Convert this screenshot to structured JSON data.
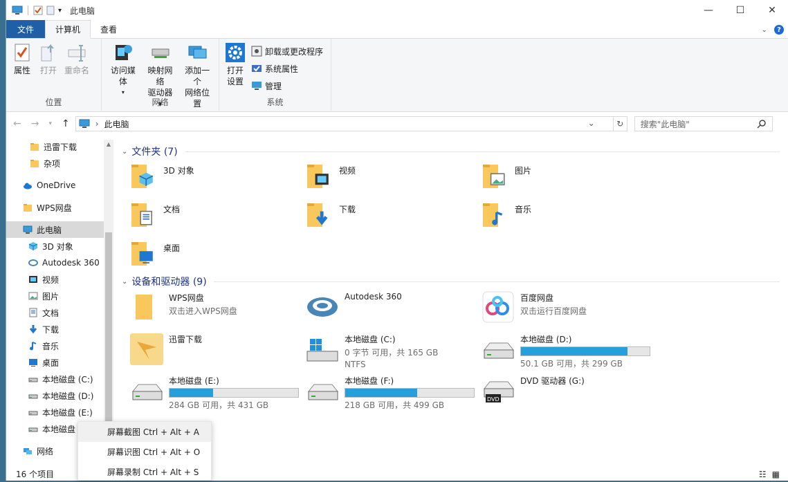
{
  "window": {
    "title": "此电脑",
    "controls": [
      "—",
      "☐",
      "✕"
    ]
  },
  "tabs": {
    "file": "文件",
    "computer": "计算机",
    "view": "查看"
  },
  "ribbon": {
    "location": {
      "label": "位置",
      "properties": "属性",
      "open": "打开",
      "rename": "重命名"
    },
    "network": {
      "label": "网络",
      "access_media": "访问媒体",
      "map_drive_1": "映射网络",
      "map_drive_2": "驱动器",
      "add_location_1": "添加一个",
      "add_location_2": "网络位置"
    },
    "system": {
      "label": "系统",
      "open_settings_1": "打开",
      "open_settings_2": "设置",
      "uninstall": "卸载或更改程序",
      "sys_props": "系统属性",
      "manage": "管理"
    }
  },
  "address": {
    "path": "此电脑",
    "search_placeholder": "搜索\"此电脑\""
  },
  "sidebar": {
    "items": [
      {
        "label": "迅雷下载",
        "icon": "folder-icon"
      },
      {
        "label": "杂项",
        "icon": "folder-icon"
      },
      {
        "label": "OneDrive",
        "icon": "cloud-icon"
      },
      {
        "label": "WPS网盘",
        "icon": "folder-icon"
      },
      {
        "label": "此电脑",
        "icon": "computer-icon"
      },
      {
        "label": "3D 对象",
        "icon": "cube-icon"
      },
      {
        "label": "Autodesk 360",
        "icon": "autodesk-icon"
      },
      {
        "label": "视频",
        "icon": "video-icon"
      },
      {
        "label": "图片",
        "icon": "picture-icon"
      },
      {
        "label": "文档",
        "icon": "document-icon"
      },
      {
        "label": "下载",
        "icon": "download-icon"
      },
      {
        "label": "音乐",
        "icon": "music-icon"
      },
      {
        "label": "桌面",
        "icon": "desktop-icon"
      },
      {
        "label": "本地磁盘 (C:)",
        "icon": "drive-icon"
      },
      {
        "label": "本地磁盘 (D:)",
        "icon": "drive-icon"
      },
      {
        "label": "本地磁盘 (E:)",
        "icon": "drive-icon"
      },
      {
        "label": "本地磁盘 (F:)",
        "icon": "drive-icon"
      },
      {
        "label": "网络",
        "icon": "network-icon"
      }
    ]
  },
  "folders": {
    "header": "文件夹 (7)",
    "items": [
      "3D 对象",
      "视频",
      "图片",
      "文档",
      "下载",
      "音乐",
      "桌面"
    ]
  },
  "devices": {
    "header": "设备和驱动器 (9)",
    "items": [
      {
        "name": "WPS网盘",
        "sub": "双击进入WPS网盘"
      },
      {
        "name": "Autodesk 360",
        "sub": ""
      },
      {
        "name": "百度网盘",
        "sub": "双击运行百度网盘"
      },
      {
        "name": "迅雷下载",
        "sub": ""
      },
      {
        "name": "本地磁盘 (C:)",
        "sub": "0 字节 可用，共 165 GB",
        "sub2": "NTFS"
      },
      {
        "name": "本地磁盘 (D:)",
        "sub": "50.1 GB 可用，共 299 GB",
        "fill": 0.83
      },
      {
        "name": "本地磁盘 (E:)",
        "sub": "284 GB 可用，共 431 GB",
        "fill": 0.34
      },
      {
        "name": "本地磁盘 (F:)",
        "sub": "218 GB 可用，共 499 GB",
        "fill": 0.56
      },
      {
        "name": "DVD 驱动器 (G:)",
        "sub": ""
      }
    ]
  },
  "status": {
    "count": "16 个项目"
  },
  "context_menu": {
    "items": [
      "屏幕截图 Ctrl + Alt + A",
      "屏幕识图 Ctrl + Alt + O",
      "屏幕录制 Ctrl + Alt + S"
    ]
  },
  "colors": {
    "accent": "#1f5fa7",
    "progress": "#26a0da",
    "folder": "#f8c85d"
  }
}
